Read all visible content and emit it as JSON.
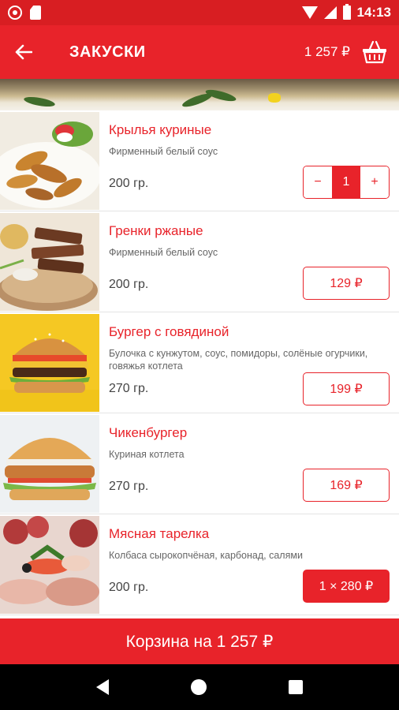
{
  "status_bar": {
    "time": "14:13"
  },
  "app_bar": {
    "title": "ЗАКУСКИ",
    "cart_total": "1 257 ₽"
  },
  "items": [
    {
      "name": "Крылья куриные",
      "desc": "Фирменный белый соус",
      "weight": "200 гр.",
      "quantity": "1",
      "minus": "−",
      "plus": "+"
    },
    {
      "name": "Гренки ржаные",
      "desc": "Фирменный белый соус",
      "weight": "200 гр.",
      "price": "129 ₽"
    },
    {
      "name": "Бургер с говядиной",
      "desc": "Булочка с кунжутом, соус, помидоры, солёные огурчики, говяжья котлета",
      "weight": "270 гр.",
      "price": "199 ₽"
    },
    {
      "name": "Чикенбургер",
      "desc": "Куриная котлета",
      "weight": "270 гр.",
      "price": "169 ₽"
    },
    {
      "name": "Мясная тарелка",
      "desc": "Колбаса сырокопчёная, карбонад, салями",
      "weight": "200 гр.",
      "price": "1 × 280 ₽"
    }
  ],
  "cart_bar": {
    "label": "Корзина на 1 257 ₽"
  },
  "colors": {
    "primary": "#e8232a",
    "status": "#d81e22"
  }
}
